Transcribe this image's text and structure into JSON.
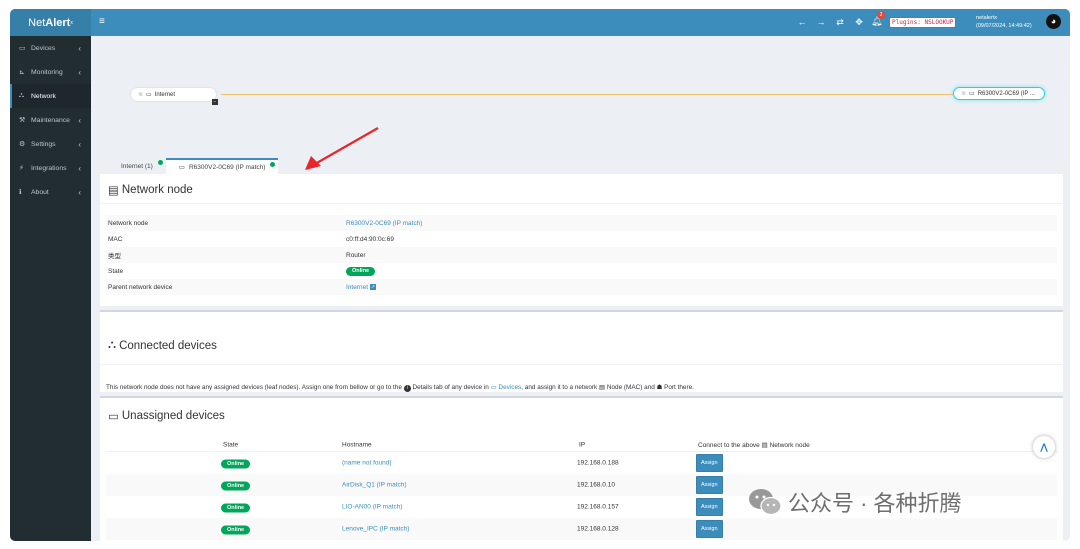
{
  "brand": {
    "prefix": "Net",
    "name": "Alert",
    "suffix": "x"
  },
  "header": {
    "notification_count": "2",
    "plugins_label": "Plugins: NSLOOKUP",
    "user_name": "netalertx",
    "timestamp": "(09/07/2024, 14:49:42)"
  },
  "sidebar": {
    "items": [
      {
        "label": "Devices",
        "icon": "laptop-icon",
        "glyph": "▭",
        "chevron": "‹"
      },
      {
        "label": "Monitoring",
        "icon": "chart-icon",
        "glyph": "⊾",
        "chevron": "‹"
      },
      {
        "label": "Network",
        "icon": "sitemap-icon",
        "glyph": "⛬",
        "chevron": ""
      },
      {
        "label": "Maintenance",
        "icon": "wrench-icon",
        "glyph": "⚒",
        "chevron": "‹"
      },
      {
        "label": "Settings",
        "icon": "cog-icon",
        "glyph": "⚙",
        "chevron": "‹"
      },
      {
        "label": "Integrations",
        "icon": "plug-icon",
        "glyph": "⚡",
        "chevron": "‹"
      },
      {
        "label": "About",
        "icon": "info-icon",
        "glyph": "ℹ",
        "chevron": "‹"
      }
    ],
    "active": "Network"
  },
  "tree": {
    "internet_label": "Internet",
    "router_label": "R6300V2-0C69 (IP ..."
  },
  "tabs": [
    {
      "label": "Internet (1)"
    },
    {
      "label": "R6300V2-0C69 (IP match)"
    }
  ],
  "network_node": {
    "title": "Network node",
    "rows": [
      {
        "key": "Network node",
        "value": "R6300V2-0C69 (IP match)"
      },
      {
        "key": "MAC",
        "value": "c0:ff:d4:90:0c:69"
      },
      {
        "key": "类型",
        "value": "Router"
      },
      {
        "key": "State",
        "value": "Online"
      },
      {
        "key": "Parent network device",
        "value": "Internet"
      }
    ]
  },
  "connected": {
    "title": "Connected devices",
    "text_a": "This network node does not have any assigned devices (leaf nodes). Assign one from bellow or go to the",
    "text_b": "Details tab of any device in",
    "devices_link": "Devices",
    "text_c": ", and assign it to a network",
    "text_d": "Node (MAC) and",
    "text_e": "Port there."
  },
  "unassigned": {
    "title": "Unassigned devices",
    "columns": {
      "state": "State",
      "hostname": "Hostname",
      "ip": "IP",
      "connect": "Connect to the above",
      "connect_suffix": "Network node"
    },
    "rows": [
      {
        "state": "Online",
        "hostname": "(name not found)",
        "ip": "192.168.0.188",
        "action": "Assign"
      },
      {
        "state": "Online",
        "hostname": "AirDisk_Q1 (IP match)",
        "ip": "192.168.0.10",
        "action": "Assign"
      },
      {
        "state": "Online",
        "hostname": "LIO-AN00 (IP match)",
        "ip": "192.168.0.157",
        "action": "Assign"
      },
      {
        "state": "Online",
        "hostname": "Lenove_IPC (IP match)",
        "ip": "192.168.0.128",
        "action": "Assign"
      }
    ]
  },
  "watermark": "公众号 · 各种折腾",
  "colors": {
    "header": "#3c8dbc",
    "sidebar": "#222d32",
    "online": "#00a65a",
    "accent": "#3c8dbc"
  }
}
